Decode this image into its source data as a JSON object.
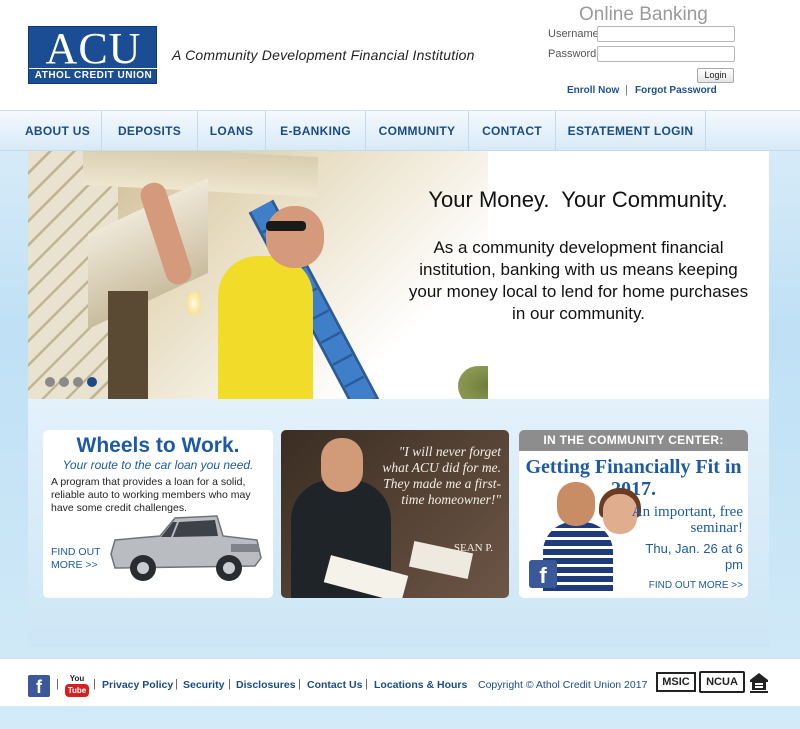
{
  "header": {
    "logo_text": "ACU",
    "logo_subtitle": "ATHOL CREDIT UNION",
    "tagline": "A Community Development Financial Institution"
  },
  "online_banking": {
    "title": "Online Banking",
    "username_label": "Username:",
    "password_label": "Password:",
    "username_value": "",
    "password_value": "",
    "login_button": "Login",
    "enroll_link": "Enroll Now",
    "separator": "|",
    "forgot_link": "Forgot Password"
  },
  "nav": {
    "items": [
      {
        "label": "ABOUT US"
      },
      {
        "label": "DEPOSITS"
      },
      {
        "label": "LOANS"
      },
      {
        "label": "E-BANKING"
      },
      {
        "label": "COMMUNITY"
      },
      {
        "label": "CONTACT"
      },
      {
        "label": "ESTATEMENT LOGIN"
      }
    ]
  },
  "hero": {
    "headline": "Your Money.  Your Community.",
    "body": "As a community development financial institution, banking with us means keeping your money local to lend for home purchases in our community.",
    "slide_count": 4,
    "active_slide": 4
  },
  "cards": {
    "wheels": {
      "title": "Wheels to Work.",
      "subtitle": "Your route to the car loan you need.",
      "body": "A program that provides a loan for a solid, reliable auto to working members who may have some credit challenges.",
      "find_out": "FIND OUT",
      "more": "MORE >>"
    },
    "testimonial": {
      "quote": "\"I will never forget what ACU did for me. They made me a first-time homeowner!\"",
      "name": "SEAN P."
    },
    "community": {
      "banner": "IN THE COMMUNITY CENTER:",
      "title": "Getting Financially Fit in 2017.",
      "promo": "An important, free seminar!",
      "date": "Thu, Jan. 26 at 6 pm",
      "find_out": "FIND OUT MORE >>"
    }
  },
  "footer": {
    "facebook_icon": "facebook-icon",
    "youtube_you": "You",
    "youtube_tube": "Tube",
    "links": [
      "Privacy Policy",
      "Security",
      "Disclosures",
      "Contact Us",
      "Locations & Hours"
    ],
    "copyright": "Copyright © Athol Credit Union 2017",
    "badges": [
      "MSIC",
      "NCUA"
    ]
  },
  "colors": {
    "brand_blue": "#1a4d94",
    "link_blue": "#1d5aa5",
    "facebook_blue": "#3b5998"
  }
}
